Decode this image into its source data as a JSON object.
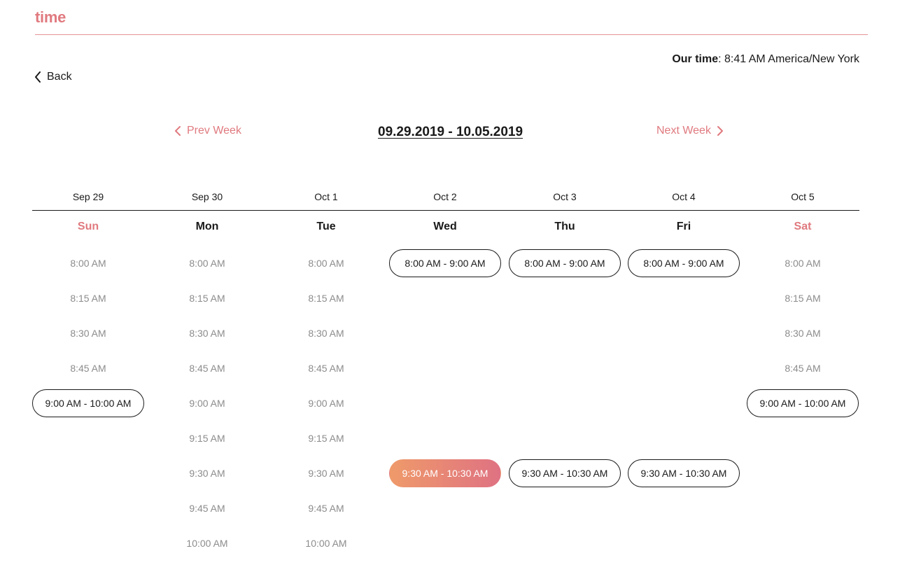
{
  "brand": {
    "name": "time",
    "accent_color": "#e07a7f"
  },
  "our_time": {
    "label": "Our time",
    "separator": ":",
    "value": "8:41 AM America/New York"
  },
  "back": {
    "label": "Back",
    "icon": "chevron-left-icon"
  },
  "week_nav": {
    "prev_label": "Prev Week",
    "next_label": "Next Week",
    "range": "09.29.2019 - 10.05.2019"
  },
  "days": [
    {
      "date": "Sep 29",
      "name": "Sun",
      "weekend": true,
      "slots": [
        {
          "kind": "time",
          "text": "8:00 AM"
        },
        {
          "kind": "time",
          "text": "8:15 AM"
        },
        {
          "kind": "time",
          "text": "8:30 AM"
        },
        {
          "kind": "time",
          "text": "8:45 AM"
        },
        {
          "kind": "range",
          "text": "9:00 AM - 10:00 AM"
        }
      ]
    },
    {
      "date": "Sep 30",
      "name": "Mon",
      "weekend": false,
      "slots": [
        {
          "kind": "time",
          "text": "8:00 AM"
        },
        {
          "kind": "time",
          "text": "8:15 AM"
        },
        {
          "kind": "time",
          "text": "8:30 AM"
        },
        {
          "kind": "time",
          "text": "8:45 AM"
        },
        {
          "kind": "time",
          "text": "9:00 AM"
        },
        {
          "kind": "time",
          "text": "9:15 AM"
        },
        {
          "kind": "time",
          "text": "9:30 AM"
        },
        {
          "kind": "time",
          "text": "9:45 AM"
        },
        {
          "kind": "time",
          "text": "10:00 AM"
        }
      ]
    },
    {
      "date": "Oct 1",
      "name": "Tue",
      "weekend": false,
      "slots": [
        {
          "kind": "time",
          "text": "8:00 AM"
        },
        {
          "kind": "time",
          "text": "8:15 AM"
        },
        {
          "kind": "time",
          "text": "8:30 AM"
        },
        {
          "kind": "time",
          "text": "8:45 AM"
        },
        {
          "kind": "time",
          "text": "9:00 AM"
        },
        {
          "kind": "time",
          "text": "9:15 AM"
        },
        {
          "kind": "time",
          "text": "9:30 AM"
        },
        {
          "kind": "time",
          "text": "9:45 AM"
        },
        {
          "kind": "time",
          "text": "10:00 AM"
        }
      ]
    },
    {
      "date": "Oct 2",
      "name": "Wed",
      "weekend": false,
      "slots": [
        {
          "kind": "range",
          "text": "8:00 AM - 9:00 AM"
        },
        {
          "kind": "empty"
        },
        {
          "kind": "empty"
        },
        {
          "kind": "empty"
        },
        {
          "kind": "empty"
        },
        {
          "kind": "empty"
        },
        {
          "kind": "range",
          "text": "9:30 AM - 10:30 AM",
          "selected": true
        }
      ]
    },
    {
      "date": "Oct 3",
      "name": "Thu",
      "weekend": false,
      "slots": [
        {
          "kind": "range",
          "text": "8:00 AM - 9:00 AM"
        },
        {
          "kind": "empty"
        },
        {
          "kind": "empty"
        },
        {
          "kind": "empty"
        },
        {
          "kind": "empty"
        },
        {
          "kind": "empty"
        },
        {
          "kind": "range",
          "text": "9:30 AM - 10:30 AM"
        }
      ]
    },
    {
      "date": "Oct 4",
      "name": "Fri",
      "weekend": false,
      "slots": [
        {
          "kind": "range",
          "text": "8:00 AM - 9:00 AM"
        },
        {
          "kind": "empty"
        },
        {
          "kind": "empty"
        },
        {
          "kind": "empty"
        },
        {
          "kind": "empty"
        },
        {
          "kind": "empty"
        },
        {
          "kind": "range",
          "text": "9:30 AM - 10:30 AM"
        }
      ]
    },
    {
      "date": "Oct 5",
      "name": "Sat",
      "weekend": true,
      "slots": [
        {
          "kind": "time",
          "text": "8:00 AM"
        },
        {
          "kind": "time",
          "text": "8:15 AM"
        },
        {
          "kind": "time",
          "text": "8:30 AM"
        },
        {
          "kind": "time",
          "text": "8:45 AM"
        },
        {
          "kind": "range",
          "text": "9:00 AM - 10:00 AM"
        }
      ]
    }
  ],
  "colors": {
    "accent": "#e07a7f",
    "selected_gradient_start": "#ef9a6a",
    "selected_gradient_end": "#df7282",
    "muted_text": "#8c8c8c",
    "text": "#1a1a1a"
  }
}
